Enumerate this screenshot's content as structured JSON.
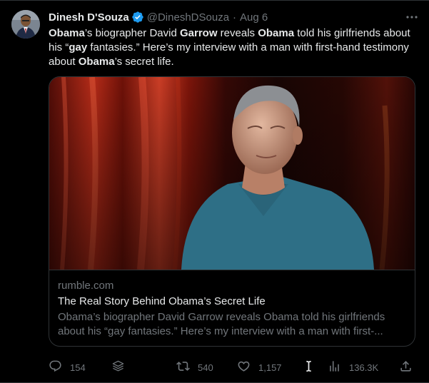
{
  "tweet": {
    "author": {
      "name": "Dinesh D'Souza",
      "handle": "@DineshDSouza",
      "separator": "·",
      "date": "Aug 6"
    },
    "text_segments": [
      {
        "text": "Obama",
        "bold": true
      },
      {
        "text": "’s biographer David ",
        "bold": false
      },
      {
        "text": "Garrow",
        "bold": true
      },
      {
        "text": " reveals ",
        "bold": false
      },
      {
        "text": "Obama",
        "bold": true
      },
      {
        "text": " told his girlfriends about his “",
        "bold": false
      },
      {
        "text": "gay",
        "bold": true
      },
      {
        "text": " fantasies.” Here’s my interview with a man with first-hand testimony about ",
        "bold": false
      },
      {
        "text": "Obama",
        "bold": true
      },
      {
        "text": "’s secret life.",
        "bold": false
      }
    ],
    "card": {
      "domain": "rumble.com",
      "title": "The Real Story Behind Obama’s Secret Life",
      "description_line1": "Obama’s biographer David Garrow reveals Obama told his girlfriends",
      "description_line2": "about his “gay fantasies.” Here’s my interview with a man with first-..."
    },
    "actions": {
      "replies": "154",
      "retweets": "540",
      "likes": "1,157",
      "views": "136.3K"
    }
  },
  "colors": {
    "background": "#000000",
    "text_primary": "#e7e9ea",
    "text_secondary": "#71767b",
    "border": "#2f3336",
    "verified": "#1d9bf0"
  },
  "icons": {
    "more": "more-horizontal-icon",
    "verified": "verified-badge-icon",
    "reply": "reply-icon",
    "stack": "stack-icon",
    "retweet": "retweet-icon",
    "like": "heart-icon",
    "cursor": "text-cursor-icon",
    "views": "views-bar-chart-icon",
    "share": "share-icon"
  }
}
